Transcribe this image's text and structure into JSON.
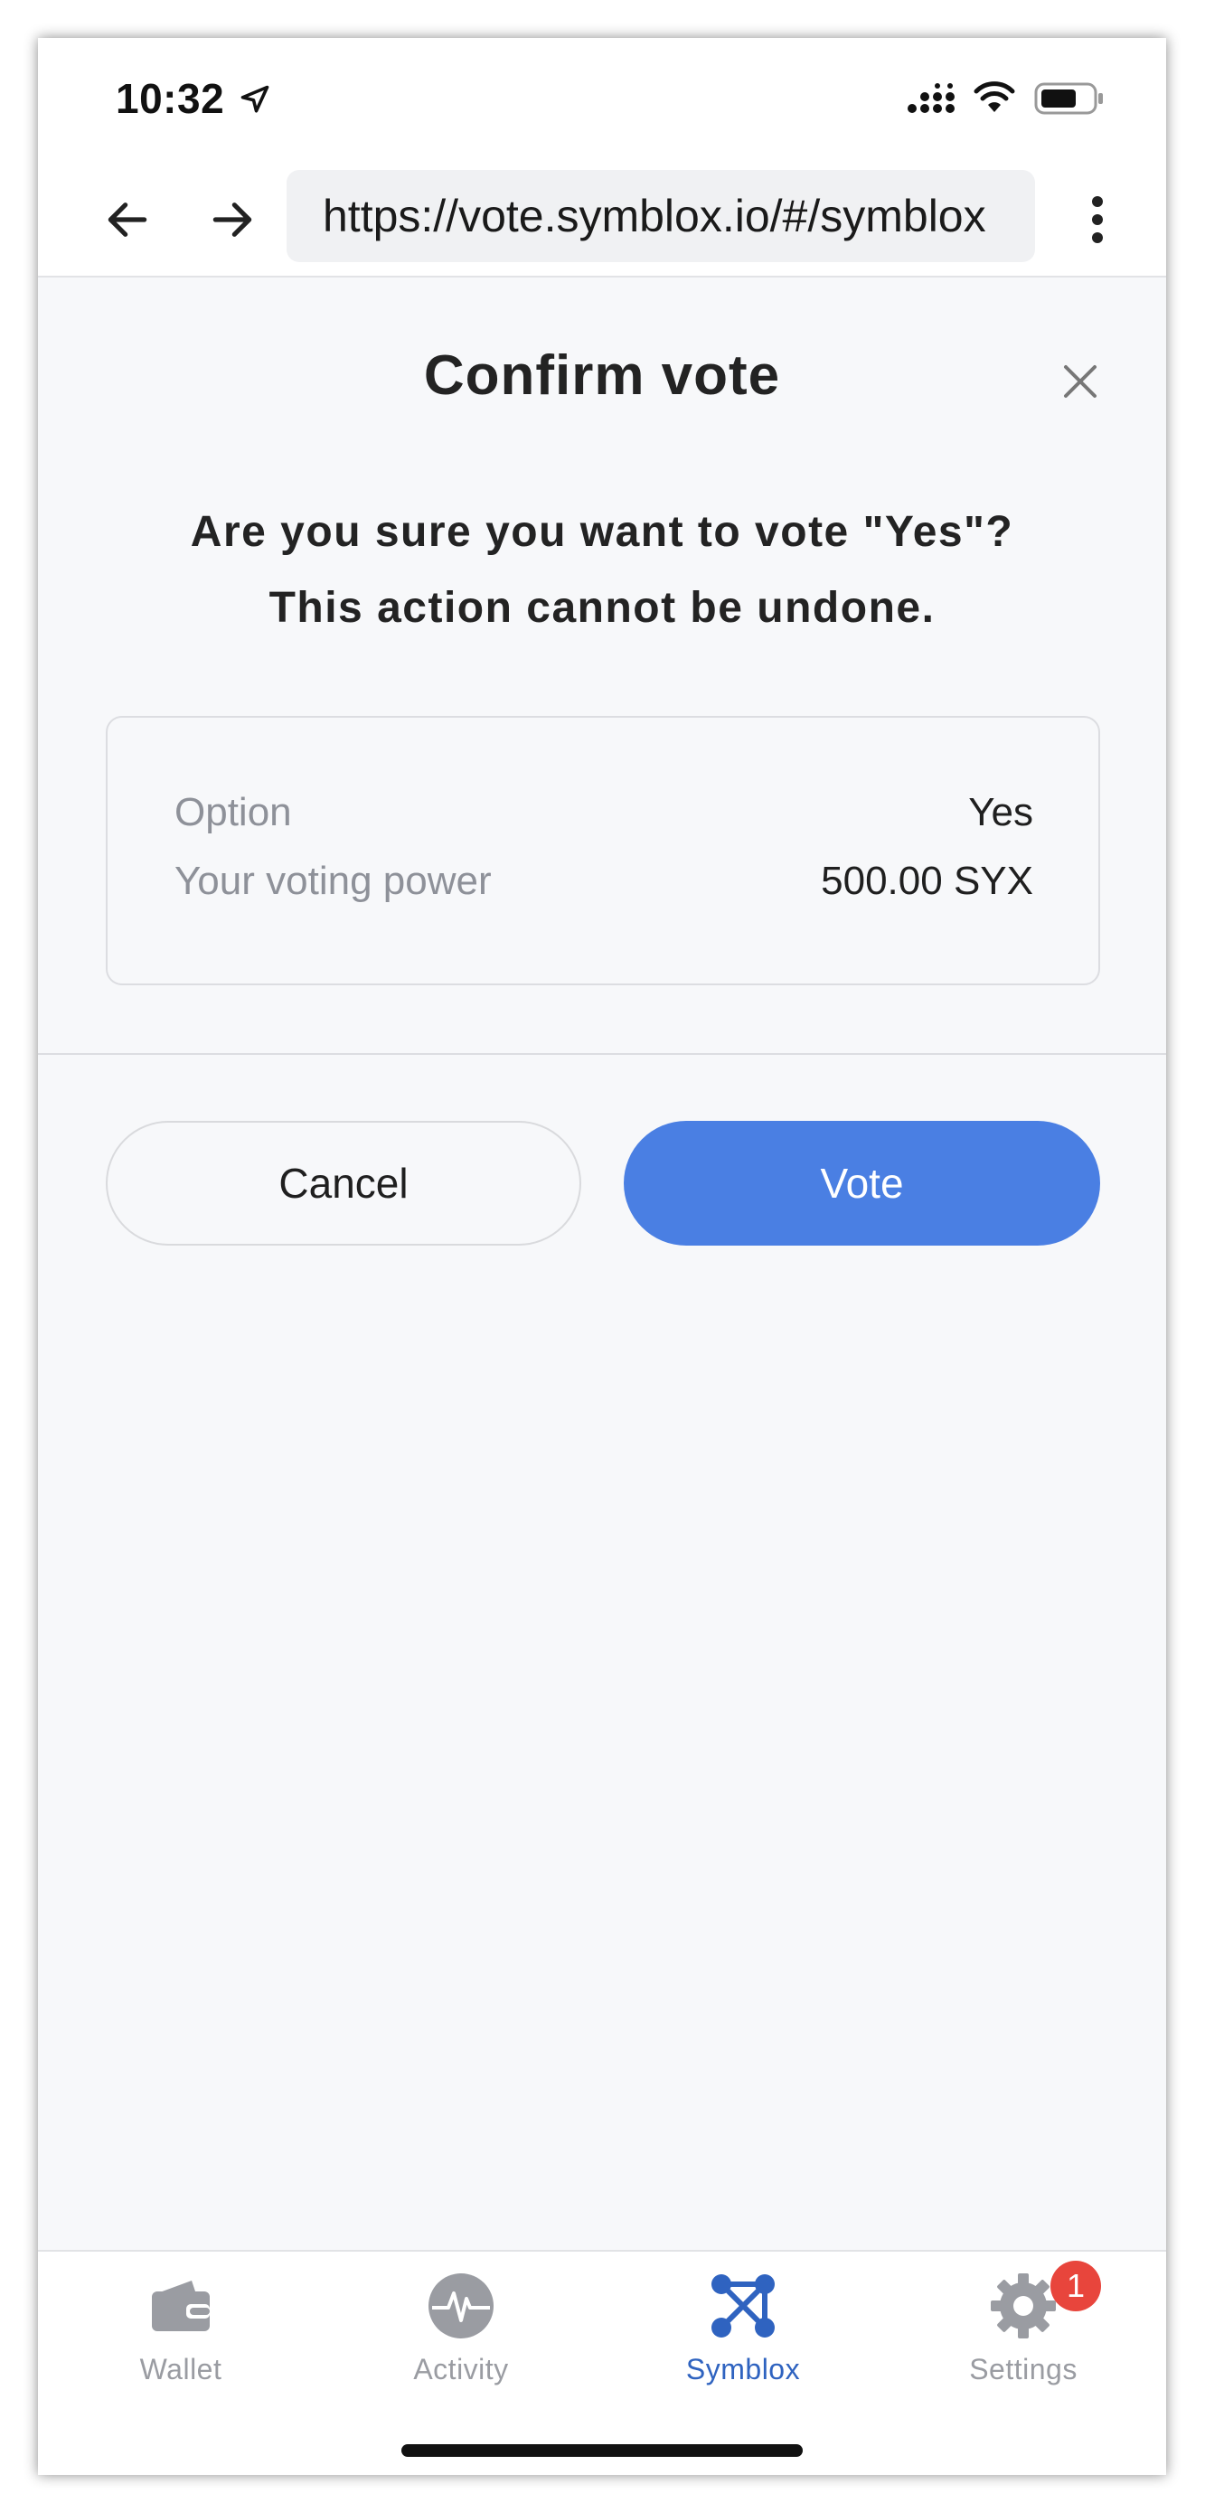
{
  "status_bar": {
    "time": "10:32"
  },
  "browser": {
    "url": "https://vote.symblox.io/#/symblox"
  },
  "modal": {
    "title": "Confirm vote",
    "question_line1": "Are you sure you want to vote \"Yes\"?",
    "question_line2": "This action cannot be undone.",
    "summary": {
      "option_label": "Option",
      "option_value": "Yes",
      "power_label": "Your voting power",
      "power_value": "500.00 SYX"
    },
    "cancel_label": "Cancel",
    "vote_label": "Vote"
  },
  "tabbar": {
    "items": [
      {
        "label": "Wallet",
        "icon": "wallet-icon"
      },
      {
        "label": "Activity",
        "icon": "activity-icon"
      },
      {
        "label": "Symblox",
        "icon": "symblox-icon",
        "active": true
      },
      {
        "label": "Settings",
        "icon": "gear-icon",
        "badge": "1"
      }
    ]
  },
  "colors": {
    "accent": "#4a7fe3",
    "active_tab": "#2f63c0",
    "badge": "#e8453c",
    "muted": "#9a9ca2"
  }
}
